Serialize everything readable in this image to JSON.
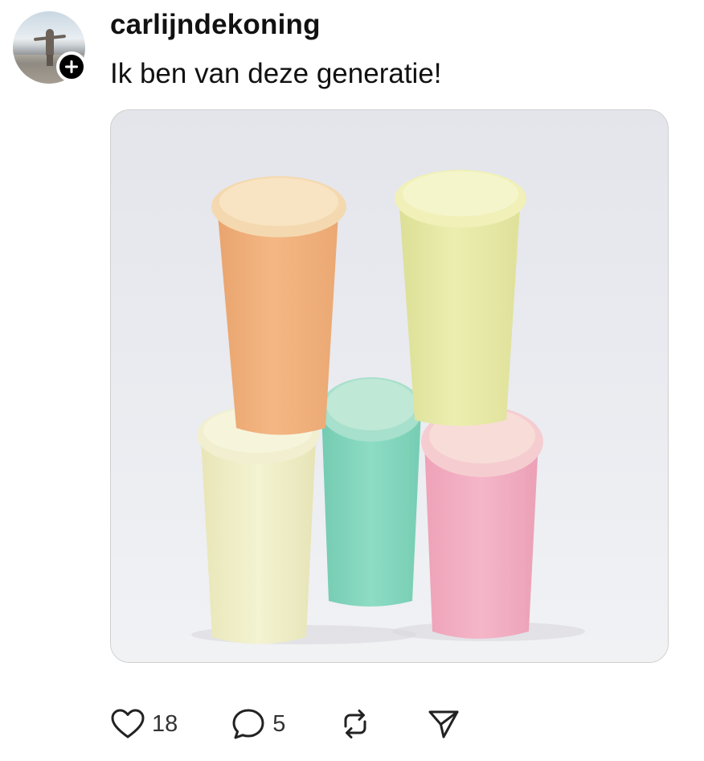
{
  "post": {
    "author": {
      "username": "carlijndekoning",
      "avatar_icon": "avatar-photo",
      "follow_icon": "plus-icon"
    },
    "text": "Ik ben van deze generatie!",
    "media": {
      "description_icon": "photo",
      "cup_colors": {
        "orange": "#f2b47e",
        "yellow": "#e6e8a4",
        "cream": "#efeec6",
        "mint": "#84d6be",
        "pink": "#f1adc2"
      }
    },
    "actions": {
      "like": {
        "icon": "heart-icon",
        "count": "18"
      },
      "reply": {
        "icon": "comment-icon",
        "count": "5"
      },
      "repost": {
        "icon": "repost-icon"
      },
      "share": {
        "icon": "send-icon"
      }
    }
  },
  "colors": {
    "text": "#111111",
    "muted": "#333333",
    "border": "#cfcfcf",
    "background": "#ffffff"
  }
}
